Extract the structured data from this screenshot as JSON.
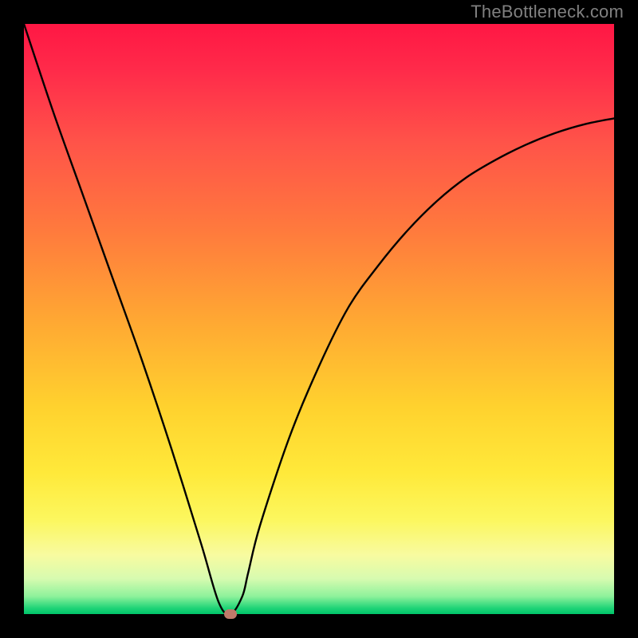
{
  "attribution": "TheBottleneck.com",
  "chart_data": {
    "type": "line",
    "title": "",
    "xlabel": "",
    "ylabel": "",
    "xlim": [
      0,
      100
    ],
    "ylim": [
      0,
      100
    ],
    "grid": false,
    "series": [
      {
        "name": "bottleneck-curve",
        "x": [
          0,
          5,
          10,
          15,
          20,
          25,
          30,
          33,
          35,
          37,
          38,
          40,
          45,
          50,
          55,
          60,
          65,
          70,
          75,
          80,
          85,
          90,
          95,
          100
        ],
        "values": [
          100,
          85,
          71,
          57,
          43,
          28,
          12,
          2,
          0,
          3,
          7,
          15,
          30,
          42,
          52,
          59,
          65,
          70,
          74,
          77,
          79.5,
          81.5,
          83,
          84
        ]
      }
    ],
    "marker": {
      "x": 35,
      "y": 0,
      "color": "#c07a6a"
    },
    "background_gradient": {
      "stops": [
        {
          "pos": 0,
          "color": "#ff1744"
        },
        {
          "pos": 50,
          "color": "#ffa733"
        },
        {
          "pos": 80,
          "color": "#ffe93a"
        },
        {
          "pos": 100,
          "color": "#00c46a"
        }
      ]
    }
  }
}
